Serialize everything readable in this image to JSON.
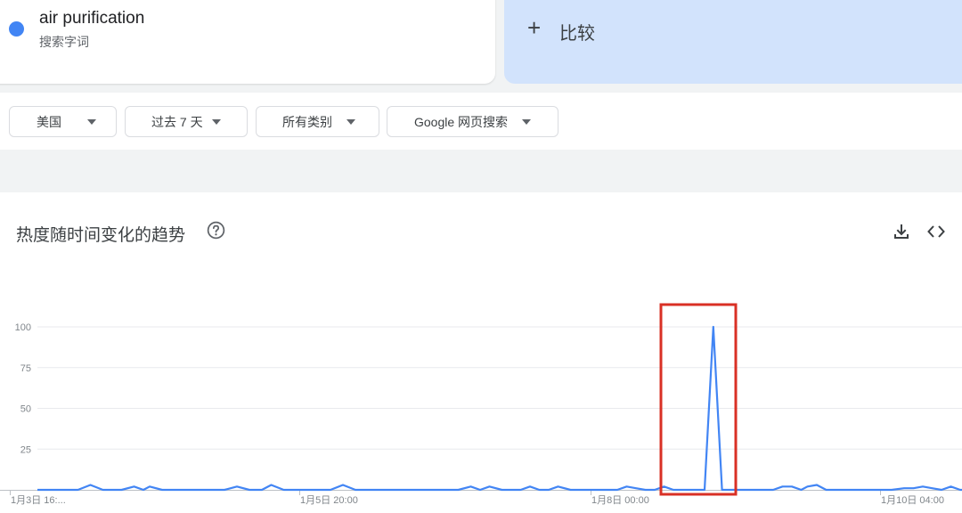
{
  "search_term": {
    "name": "air purification",
    "type": "搜索字词",
    "color": "#4285f4"
  },
  "compare": {
    "icon": "plus-icon",
    "label": "比较"
  },
  "filters": [
    {
      "label": "美国"
    },
    {
      "label": "过去 7 天"
    },
    {
      "label": "所有类别"
    },
    {
      "label": "Google 网页搜索"
    }
  ],
  "chart_section": {
    "title": "热度随时间变化的趋势",
    "icons": [
      "help-icon",
      "download-icon",
      "embed-icon"
    ]
  },
  "chart_data": {
    "type": "line",
    "title": "",
    "xlabel": "",
    "ylabel": "",
    "ylim": [
      0,
      100
    ],
    "y_ticks": [
      100,
      75,
      50,
      25
    ],
    "x_tick_labels": [
      "1月3日 16:...",
      "1月5日 20:00",
      "1月8日 00:00",
      "1月10日 04:00"
    ],
    "grid": true,
    "series": [
      {
        "color": "#4285f4",
        "points": [
          [
            0,
            0
          ],
          [
            13,
            0
          ],
          [
            17,
            3
          ],
          [
            21,
            0
          ],
          [
            27,
            0
          ],
          [
            31,
            2
          ],
          [
            34,
            0
          ],
          [
            36,
            2
          ],
          [
            40,
            0
          ],
          [
            60,
            0
          ],
          [
            64,
            2
          ],
          [
            68,
            0
          ],
          [
            72,
            0
          ],
          [
            75,
            3
          ],
          [
            79,
            0
          ],
          [
            94,
            0
          ],
          [
            98,
            3
          ],
          [
            102,
            0
          ],
          [
            135,
            0
          ],
          [
            139,
            2
          ],
          [
            142,
            0
          ],
          [
            145,
            2
          ],
          [
            149,
            0
          ],
          [
            155,
            0
          ],
          [
            158,
            2
          ],
          [
            161,
            0
          ],
          [
            164,
            0
          ],
          [
            167,
            2
          ],
          [
            171,
            0
          ],
          [
            186,
            0
          ],
          [
            189,
            2
          ],
          [
            192,
            1
          ],
          [
            195,
            0
          ],
          [
            198,
            0
          ],
          [
            201,
            2
          ],
          [
            204,
            0
          ],
          [
            214,
            0
          ],
          [
            216.8,
            100
          ],
          [
            219.6,
            0
          ],
          [
            236,
            0
          ],
          [
            239,
            2
          ],
          [
            242,
            2
          ],
          [
            245,
            0
          ],
          [
            247,
            2
          ],
          [
            250,
            3
          ],
          [
            253,
            0
          ],
          [
            274,
            0
          ],
          [
            278,
            1
          ],
          [
            281,
            1
          ],
          [
            284,
            2
          ],
          [
            287,
            1
          ],
          [
            290,
            0
          ],
          [
            293,
            2
          ],
          [
            296,
            0
          ],
          [
            299,
            0
          ],
          [
            302,
            1
          ],
          [
            306,
            0
          ]
        ]
      }
    ],
    "annotation": {
      "type": "highlight-box",
      "color": "#d93025"
    }
  }
}
